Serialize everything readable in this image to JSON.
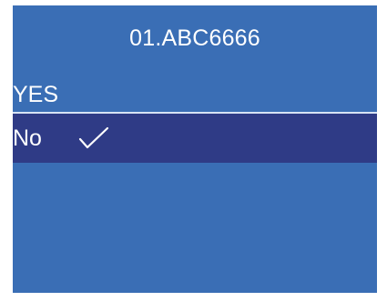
{
  "screen": {
    "title": "01.ABC6666",
    "options": [
      {
        "label": "YES",
        "selected": false
      },
      {
        "label": "No",
        "selected": true
      }
    ],
    "colors": {
      "background": "#3a6eb5",
      "selected_row": "#2f3b86",
      "text": "#ffffff"
    },
    "check_icon": "check-icon"
  }
}
